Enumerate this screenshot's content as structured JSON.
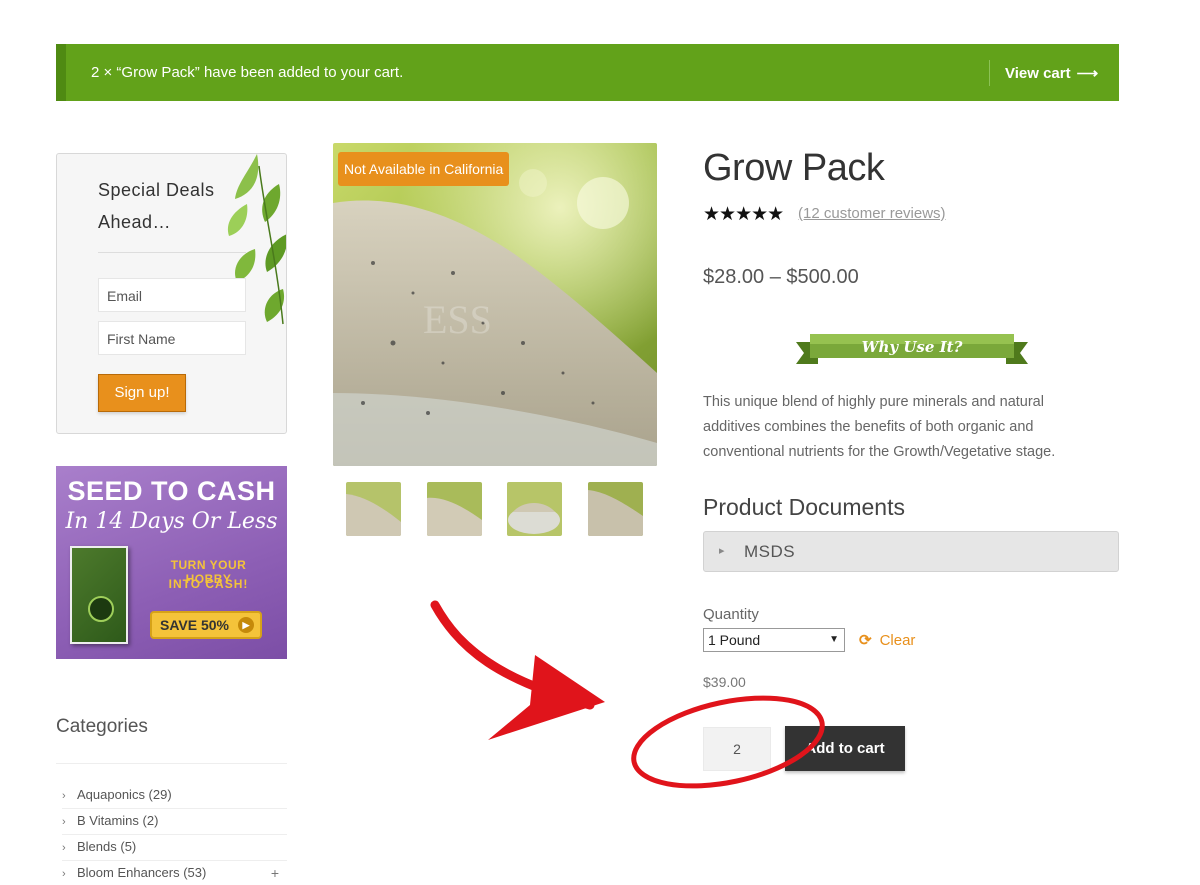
{
  "notice": {
    "message": "2 × “Grow Pack” have been added to your cart.",
    "view_cart": "View cart",
    "arrow": "⟶"
  },
  "newsletter": {
    "title": "Special Deals Ahead…",
    "email_placeholder": "Email",
    "first_name_placeholder": "First Name",
    "signup_label": "Sign up!"
  },
  "promo": {
    "title": "SEED TO CASH",
    "subtitle": "In 14 Days Or Less",
    "line1": "TURN YOUR HOBBY",
    "line2": "INTO CASH!",
    "button": "SAVE 50%"
  },
  "categories": {
    "title": "Categories",
    "items": [
      {
        "label": "Aquaponics (29)"
      },
      {
        "label": "B Vitamins (2)"
      },
      {
        "label": "Blends (5)"
      },
      {
        "label": "Bloom Enhancers (53)",
        "expand": "+"
      }
    ]
  },
  "product": {
    "badge": "Not Available in California",
    "title": "Grow Pack",
    "stars": "★★★★★",
    "rating": 5,
    "reviews": "(12 customer reviews)",
    "price_range": "$28.00 – $500.00",
    "ribbon": "Why Use It?",
    "description": "This unique blend of highly pure minerals and natural additives combines the benefits of both organic and conventional nutrients for the Growth/Vegetative stage.",
    "docs_title": "Product Documents",
    "msds": "MSDS",
    "quantity_label": "Quantity",
    "selected_option": "1 Pound",
    "clear_label": "Clear",
    "variation_price": "$39.00",
    "quantity_value": "2",
    "add_to_cart": "Add to cart"
  },
  "colors": {
    "notice_green": "#62a21a",
    "accent_orange": "#e8901c",
    "button_dark": "#333333",
    "annotation_red": "#e0141b"
  }
}
